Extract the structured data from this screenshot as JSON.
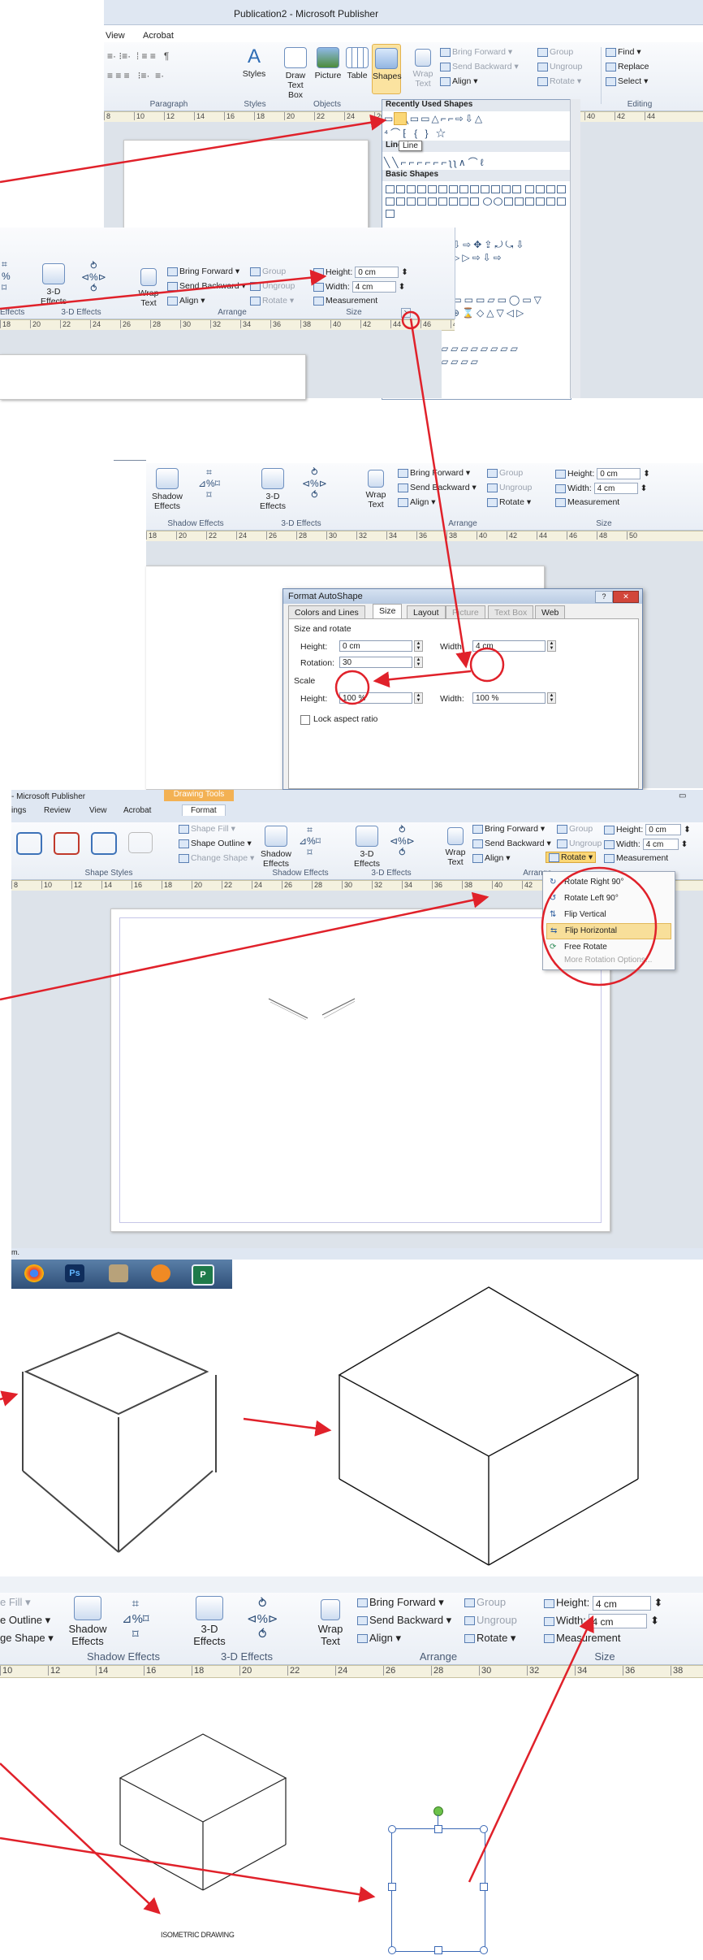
{
  "panel1": {
    "window_title": "Publication2 - Microsoft Publisher",
    "menu_tabs": [
      "View",
      "Acrobat"
    ],
    "groups": [
      "Paragraph",
      "Styles",
      "Objects",
      "Editing"
    ],
    "buttons": {
      "styles": "Styles",
      "draw_text_box": "Draw Text Box",
      "picture": "Picture",
      "table": "Table",
      "shapes": "Shapes",
      "wrap_text": "Wrap Text",
      "bring_forward": "Bring Forward",
      "send_backward": "Send Backward",
      "align": "Align",
      "group": "Group",
      "ungroup": "Ungroup",
      "rotate": "Rotate",
      "find": "Find",
      "replace": "Replace",
      "select": "Select"
    },
    "shapes_dropdown": {
      "recent_header": "Recently Used Shapes",
      "lines_header": "Lines",
      "tooltip": "Line",
      "basic_header": "Basic Shapes"
    }
  },
  "panel2": {
    "group_labels": [
      "Effects",
      "3-D Effects",
      "Arrange",
      "Size"
    ],
    "buttons": {
      "three_d_effects": "3-D Effects",
      "wrap_text": "Wrap Text",
      "bring_forward": "Bring Forward",
      "send_backward": "Send Backward",
      "align": "Align",
      "group": "Group",
      "ungroup": "Ungroup",
      "rotate": "Rotate",
      "measurement": "Measurement"
    },
    "height_label": "Height:",
    "height_value": "0 cm",
    "width_label": "Width:",
    "width_value": "4 cm"
  },
  "panel3": {
    "group_labels": [
      "Shadow Effects",
      "3-D Effects",
      "Arrange",
      "Size"
    ],
    "buttons": {
      "shadow_effects": "Shadow Effects",
      "three_d_effects": "3-D Effects",
      "wrap_text": "Wrap Text",
      "bring_forward": "Bring Forward",
      "send_backward": "Send Backward",
      "align": "Align",
      "group": "Group",
      "ungroup": "Ungroup",
      "rotate": "Rotate",
      "measurement": "Measurement"
    },
    "height_label": "Height:",
    "height_value": "0 cm",
    "width_label": "Width:",
    "width_value": "4 cm"
  },
  "dialog": {
    "title": "Format AutoShape",
    "tabs": [
      "Colors and Lines",
      "Size",
      "Layout",
      "Picture",
      "Text Box",
      "Web"
    ],
    "section_size": "Size and rotate",
    "height_label": "Height:",
    "height_value": "0 cm",
    "width_label": "Width:",
    "width_value": "4 cm",
    "rotation_label": "Rotation:",
    "rotation_value": "30",
    "section_scale": "Scale",
    "scale_height_label": "Height:",
    "scale_height_value": "100 %",
    "scale_width_label": "Width:",
    "scale_width_value": "100 %",
    "lock_aspect_label": "Lock aspect ratio"
  },
  "panel4": {
    "window_title": "- Microsoft Publisher",
    "context_tab": "Drawing Tools",
    "tabs": [
      "ings",
      "Review",
      "View",
      "Acrobat",
      "Format"
    ],
    "group_labels": [
      "Shape Styles",
      "Shadow Effects",
      "3-D Effects",
      "Arrange"
    ],
    "buttons": {
      "shape_fill": "Shape Fill",
      "shape_outline": "Shape Outline",
      "change_shape": "Change Shape",
      "shadow_effects": "Shadow Effects",
      "three_d_effects": "3-D Effects",
      "wrap_text": "Wrap Text",
      "bring_forward": "Bring Forward",
      "send_backward": "Send Backward",
      "align": "Align",
      "group": "Group",
      "ungroup": "Ungroup",
      "rotate": "Rotate",
      "measurement": "Measurement"
    },
    "height_label": "Height:",
    "height_value": "0 cm",
    "width_label": "Width:",
    "width_value": "4 cm",
    "rotate_menu": [
      "Rotate Right 90°",
      "Rotate Left 90°",
      "Flip Vertical",
      "Flip Horizontal",
      "Free Rotate",
      "More Rotation Options..."
    ],
    "status_text": "m.",
    "taskbar_icons": [
      "chrome-icon",
      "photoshop-icon",
      "app-icon",
      "media-icon",
      "publisher-icon"
    ],
    "taskbar_labels": {
      "ps": "Ps",
      "pub": "P"
    }
  },
  "panel6": {
    "group_labels": [
      "Shadow Effects",
      "3-D Effects",
      "Arrange",
      "Size"
    ],
    "buttons": {
      "shape_fill": "e Fill",
      "shape_outline": "e Outline",
      "change_shape": "ge Shape",
      "shadow_effects": "Shadow Effects",
      "three_d_effects": "3-D Effects",
      "wrap_text": "Wrap Text",
      "bring_forward": "Bring Forward",
      "send_backward": "Send Backward",
      "align": "Align",
      "group": "Group",
      "ungroup": "Ungroup",
      "rotate": "Rotate",
      "measurement": "Measurement"
    },
    "height_label": "Height:",
    "height_value": "4 cm",
    "width_label": "Width:",
    "width_value": "4 cm",
    "caption": "ISOMETRIC DRAWING"
  },
  "ruler_ticks_a": [
    "8",
    "10",
    "12",
    "14",
    "16",
    "18",
    "20",
    "22",
    "24",
    "26",
    "28",
    "30",
    "32",
    "34",
    "36",
    "38",
    "40",
    "42",
    "44"
  ],
  "ruler_ticks_b": [
    "18",
    "20",
    "22",
    "24",
    "26",
    "28",
    "30",
    "32",
    "34",
    "36",
    "38",
    "40",
    "42",
    "44",
    "46",
    "48",
    "50"
  ],
  "ruler_ticks_c": [
    "10",
    "12",
    "14",
    "16",
    "18",
    "20",
    "22",
    "24",
    "26",
    "28",
    "30",
    "32",
    "34",
    "36",
    "38"
  ],
  "colors": {
    "annotation_red": "#e0212a",
    "ribbon_blue": "#dce6f3",
    "highlight": "#f8df9a"
  }
}
